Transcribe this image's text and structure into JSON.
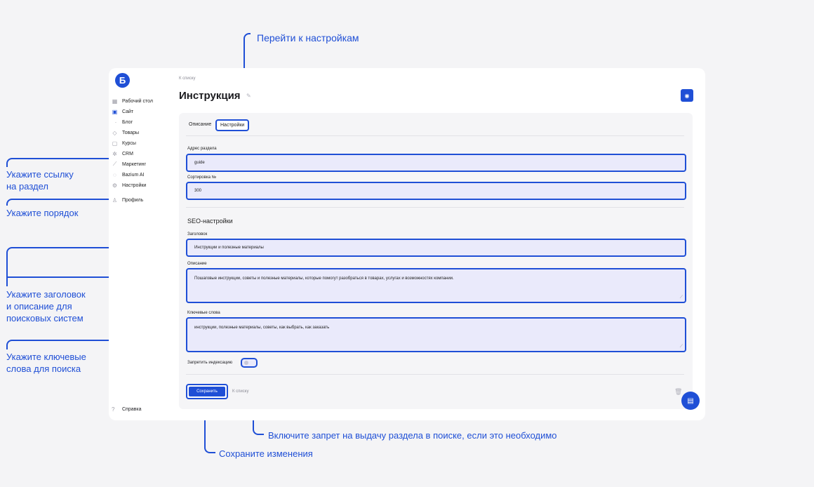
{
  "app": {
    "logo_letter": "Б",
    "accent_color": "#1f4fd6"
  },
  "sidebar": {
    "items": [
      {
        "label": "Рабочий стол",
        "icon": "dashboard-icon"
      },
      {
        "label": "Сайт",
        "icon": "site-icon"
      },
      {
        "label": "Блог",
        "icon": "dot-icon"
      },
      {
        "label": "Товары",
        "icon": "bag-icon"
      },
      {
        "label": "Курсы",
        "icon": "book-icon"
      },
      {
        "label": "CRM",
        "icon": "crm-icon"
      },
      {
        "label": "Маркетинг",
        "icon": "chart-icon"
      },
      {
        "label": "Bazium AI",
        "icon": "ai-icon"
      },
      {
        "label": "Настройки",
        "icon": "gear-icon"
      },
      {
        "label": "Профиль",
        "icon": "user-icon"
      }
    ],
    "help_label": "Справка"
  },
  "header": {
    "breadcrumb": "К списку",
    "title": "Инструкция"
  },
  "tabs": [
    {
      "label": "Описание"
    },
    {
      "label": "Настройки"
    }
  ],
  "form": {
    "address_label": "Адрес раздела",
    "address_value": "guide",
    "sort_label": "Сортировка №",
    "sort_value": "300",
    "seo_heading": "SEO-настройки",
    "title_label": "Заголовок",
    "title_value": "Инструкции и полезные материалы",
    "description_label": "Описание",
    "description_value": "Пошаговые инструкции, советы и полезные материалы, которые помогут разобраться в товарах, услугах и возможностях компании.",
    "keywords_label": "Ключевые слова",
    "keywords_value": "инструкции, полезные материалы, советы, как выбрать, как заказать",
    "noindex_label": "Запретить индексацию"
  },
  "actions": {
    "save_label": "Сохранить",
    "back_label": "К списку"
  },
  "callouts": {
    "settings": "Перейти к настройкам",
    "link": "Укажите ссылку\nна раздел",
    "order": "Укажите порядок",
    "seo": "Укажите заголовок\nи описание для\nпоисковых систем",
    "keywords": "Укажите ключевые\nслова для поиска",
    "noindex": "Включите запрет на выдачу раздела в поиске, если это необходимо",
    "save": "Сохраните изменения"
  }
}
